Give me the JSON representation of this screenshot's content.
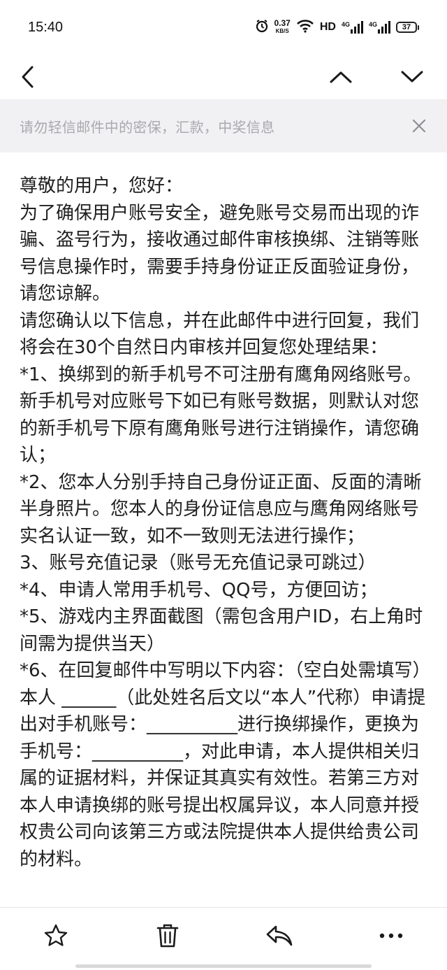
{
  "status_bar": {
    "time": "15:40",
    "speed_value": "0.37",
    "speed_unit": "KB/S",
    "hd_label": "HD",
    "network_label_1": "4G",
    "network_label_2": "4G",
    "battery_level": "37"
  },
  "toolbar": {
    "back_icon": "chevron-left-icon",
    "prev_icon": "chevron-up-icon",
    "next_icon": "chevron-down-icon"
  },
  "warning": {
    "text": "请勿轻信邮件中的密保，汇款，中奖信息",
    "close_icon": "close-icon"
  },
  "email": {
    "paragraphs": [
      "尊敬的用户，您好：",
      "为了确保用户账号安全，避免账号交易而出现的诈骗、盗号行为，接收通过邮件审核换绑、注销等账号信息操作时，需要手持身份证正反面验证身份，请您谅解。",
      "请您确认以下信息，并在此邮件中进行回复，我们将会在30个自然日内审核并回复您处理结果：",
      "*1、换绑到的新手机号不可注册有鹰角网络账号。新手机号对应账号下如已有账号数据，则默认对您的新手机号下原有鹰角账号进行注销操作，请您确认；",
      "*2、您本人分别手持自己身份证正面、反面的清晰半身照片。您本人的身份证信息应与鹰角网络账号实名认证一致，如不一致则无法进行操作；",
      "3、账号充值记录（账号无充值记录可跳过）",
      "*4、申请人常用手机号、QQ号，方便回访；",
      "*5、游戏内主界面截图（需包含用户ID，右上角时间需为提供当天）",
      "*6、在回复邮件中写明以下内容：（空白处需填写）",
      "本人 ______（此处姓名后文以“本人”代称）申请提出对手机账号：__________进行换绑操作，更换为手机号：__________，对此申请，本人提供相关归属的证据材料，并保证其真实有效性。若第三方对本人申请换绑的账号提出权属异议，本人同意并授权贵公司向该第三方或法院提供本人提供给贵公司的材料。"
    ]
  },
  "bottom_bar": {
    "star_icon": "star-icon",
    "delete_icon": "trash-icon",
    "reply_icon": "reply-icon",
    "more_icon": "more-icon"
  }
}
